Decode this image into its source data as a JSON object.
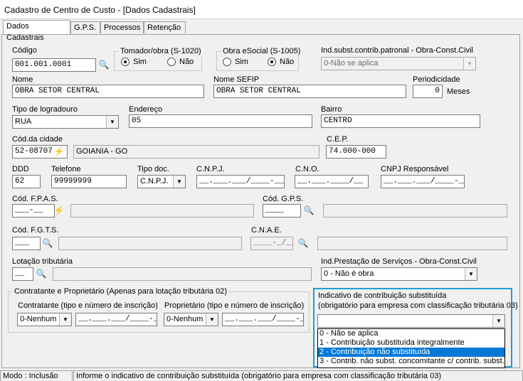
{
  "window": {
    "title": "Cadastro de Centro de Custo - [Dados Cadastrais]"
  },
  "tabs": [
    {
      "label": "Dados Cadastrais"
    },
    {
      "label": "G.P.S."
    },
    {
      "label": "Processos"
    },
    {
      "label": "Retenção"
    }
  ],
  "form": {
    "codigo": {
      "label": "Código",
      "value": "001.001.0001"
    },
    "tomador": {
      "label": "Tomador/obra (S-1020)",
      "sim": "Sim",
      "nao": "Não",
      "selected": "sim"
    },
    "obra_esocial": {
      "label": "Obra eSocial (S-1005)",
      "sim": "Sim",
      "nao": "Não",
      "selected": "nao"
    },
    "ind_subst": {
      "label": "Ind.subst.contrib.patronal - Obra-Const.Civil",
      "value": "0-Não se aplica"
    },
    "nome": {
      "label": "Nome",
      "value": "OBRA SETOR CENTRAL"
    },
    "nome_sefip": {
      "label": "Nome SEFIP",
      "value": "OBRA SETOR CENTRAL"
    },
    "periodicidade": {
      "label": "Periodicidade",
      "value": "0",
      "unit": "Meses"
    },
    "tipo_logradouro": {
      "label": "Tipo de logradouro",
      "value": "RUA"
    },
    "endereco": {
      "label": "Endereço",
      "value": "05"
    },
    "bairro": {
      "label": "Bairro",
      "value": "CENTRO"
    },
    "cod_cidade": {
      "label": "Cód.da cidade",
      "value": "52-08707",
      "cidade": "GOIANIA - GO"
    },
    "cep": {
      "label": "C.E.P.",
      "value": "74.000-000"
    },
    "ddd": {
      "label": "DDD",
      "value": "62"
    },
    "telefone": {
      "label": "Telefone",
      "value": "99999999"
    },
    "tipo_doc": {
      "label": "Tipo doc.",
      "value": "C.N.P.J."
    },
    "cnpj": {
      "label": "C.N.P.J.",
      "mask": "__.___.___/____-__"
    },
    "cno": {
      "label": "C.N.O.",
      "mask": "__.___.____/__"
    },
    "cnpj_resp": {
      "label": "CNPJ Responsável",
      "mask": "__.___.___/____-__"
    },
    "cod_fpas": {
      "label": "Cód. F.P.A.S.",
      "mask": "___-__"
    },
    "cod_gps": {
      "label": "Cód. G.P.S.",
      "mask": "____"
    },
    "cod_fgts": {
      "label": "Cód. F.G.T.S.",
      "mask": "___"
    },
    "cnae": {
      "label": "C.N.A.E.",
      "mask": "____-_/__"
    },
    "lotacao": {
      "label": "Lotação tributária",
      "mask": "__"
    },
    "ind_prestacao": {
      "label": "Ind.Prestação de Serviços - Obra-Const.Civil",
      "value": "0 - Não é obra"
    },
    "contratante_group": {
      "label": "Contratante e Proprietário (Apenas para lotação tributária 02)",
      "contratante_label": "Contratante (tipo e número de inscrição)",
      "contratante_tipo": "0-Nenhum",
      "contratante_mask": "__.___.___/____-__",
      "proprietario_label": "Proprietário (tipo e número de inscrição)",
      "proprietario_tipo": "0-Nenhum",
      "proprietario_mask": "__.___.___/____-__"
    },
    "ind_contrib": {
      "label1": "Indicativo de contribuição substituída",
      "label2": "(obrigatório para empresa com classificação tributária 03)",
      "value": "",
      "options": [
        "0 - Não se aplica",
        "1 - Contribuição substituída integralmente",
        "2 - Contribuição não substituída",
        "3 - Contrib. não subst. concomitante c/ contrib. subst."
      ],
      "highlighted_index": 2
    }
  },
  "statusbar": {
    "mode": "Modo : Inclusão",
    "message": "Informe o indicativo de contribuição substituída (obrigatório para empresa com classificação tributária 03)"
  },
  "accent_color": "#1e9fd3",
  "selection_color": "#0078d7"
}
